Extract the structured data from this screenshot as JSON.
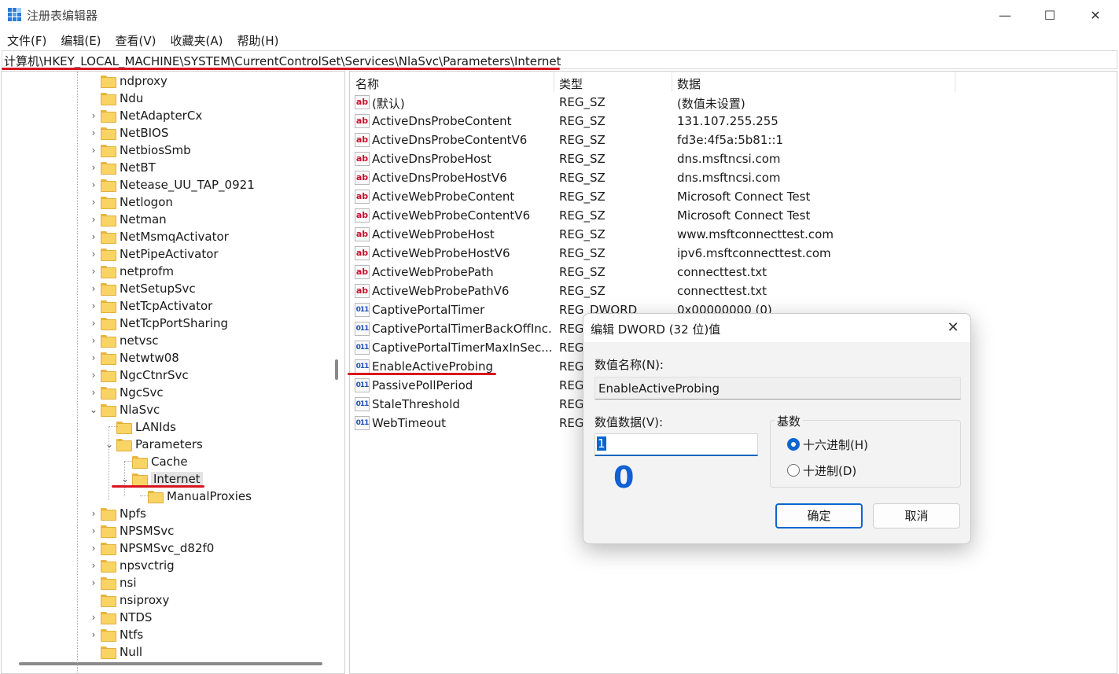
{
  "window": {
    "title": "注册表编辑器",
    "controls": {
      "minimize": "—",
      "maximize": "☐",
      "close": "✕"
    }
  },
  "menu": [
    "文件(F)",
    "编辑(E)",
    "查看(V)",
    "收藏夹(A)",
    "帮助(H)"
  ],
  "address": "计算机\\HKEY_LOCAL_MACHINE\\SYSTEM\\CurrentControlSet\\Services\\NlaSvc\\Parameters\\Internet",
  "tree": [
    {
      "label": "ndproxy",
      "expand": ""
    },
    {
      "label": "Ndu",
      "expand": ""
    },
    {
      "label": "NetAdapterCx",
      "expand": "›"
    },
    {
      "label": "NetBIOS",
      "expand": "›"
    },
    {
      "label": "NetbiosSmb",
      "expand": "›"
    },
    {
      "label": "NetBT",
      "expand": "›"
    },
    {
      "label": "Netease_UU_TAP_0921",
      "expand": "›"
    },
    {
      "label": "Netlogon",
      "expand": "›"
    },
    {
      "label": "Netman",
      "expand": "›"
    },
    {
      "label": "NetMsmqActivator",
      "expand": "›"
    },
    {
      "label": "NetPipeActivator",
      "expand": "›"
    },
    {
      "label": "netprofm",
      "expand": "›"
    },
    {
      "label": "NetSetupSvc",
      "expand": "›"
    },
    {
      "label": "NetTcpActivator",
      "expand": "›"
    },
    {
      "label": "NetTcpPortSharing",
      "expand": "›"
    },
    {
      "label": "netvsc",
      "expand": "›"
    },
    {
      "label": "Netwtw08",
      "expand": "›"
    },
    {
      "label": "NgcCtnrSvc",
      "expand": "›"
    },
    {
      "label": "NgcSvc",
      "expand": "›"
    },
    {
      "label": "NlaSvc",
      "expand": "⌄"
    },
    {
      "label": "LANIds",
      "expand": ""
    },
    {
      "label": "Parameters",
      "expand": "⌄"
    },
    {
      "label": "Cache",
      "expand": ""
    },
    {
      "label": "Internet",
      "expand": "⌄"
    },
    {
      "label": "ManualProxies",
      "expand": ""
    },
    {
      "label": "Npfs",
      "expand": "›"
    },
    {
      "label": "NPSMSvc",
      "expand": "›"
    },
    {
      "label": "NPSMSvc_d82f0",
      "expand": "›"
    },
    {
      "label": "npsvctrig",
      "expand": "›"
    },
    {
      "label": "nsi",
      "expand": "›"
    },
    {
      "label": "nsiproxy",
      "expand": ""
    },
    {
      "label": "NTDS",
      "expand": "›"
    },
    {
      "label": "Ntfs",
      "expand": "›"
    },
    {
      "label": "Null",
      "expand": ""
    }
  ],
  "columns": {
    "name": "名称",
    "type": "类型",
    "data": "数据"
  },
  "values": [
    {
      "icon": "ab",
      "name": "(默认)",
      "type": "REG_SZ",
      "data": "(数值未设置)"
    },
    {
      "icon": "ab",
      "name": "ActiveDnsProbeContent",
      "type": "REG_SZ",
      "data": "131.107.255.255"
    },
    {
      "icon": "ab",
      "name": "ActiveDnsProbeContentV6",
      "type": "REG_SZ",
      "data": "fd3e:4f5a:5b81::1"
    },
    {
      "icon": "ab",
      "name": "ActiveDnsProbeHost",
      "type": "REG_SZ",
      "data": "dns.msftncsi.com"
    },
    {
      "icon": "ab",
      "name": "ActiveDnsProbeHostV6",
      "type": "REG_SZ",
      "data": "dns.msftncsi.com"
    },
    {
      "icon": "ab",
      "name": "ActiveWebProbeContent",
      "type": "REG_SZ",
      "data": "Microsoft Connect Test"
    },
    {
      "icon": "ab",
      "name": "ActiveWebProbeContentV6",
      "type": "REG_SZ",
      "data": "Microsoft Connect Test"
    },
    {
      "icon": "ab",
      "name": "ActiveWebProbeHost",
      "type": "REG_SZ",
      "data": "www.msftconnecttest.com"
    },
    {
      "icon": "ab",
      "name": "ActiveWebProbeHostV6",
      "type": "REG_SZ",
      "data": "ipv6.msftconnecttest.com"
    },
    {
      "icon": "ab",
      "name": "ActiveWebProbePath",
      "type": "REG_SZ",
      "data": "connecttest.txt"
    },
    {
      "icon": "ab",
      "name": "ActiveWebProbePathV6",
      "type": "REG_SZ",
      "data": "connecttest.txt"
    },
    {
      "icon": "011",
      "name": "CaptivePortalTimer",
      "type": "REG_DWORD",
      "data": "0x00000000 (0)"
    },
    {
      "icon": "011",
      "name": "CaptivePortalTimerBackOffInc...",
      "type": "REG_",
      "data": ""
    },
    {
      "icon": "011",
      "name": "CaptivePortalTimerMaxInSec...",
      "type": "REG_",
      "data": ""
    },
    {
      "icon": "011",
      "name": "EnableActiveProbing",
      "type": "REG_",
      "data": ""
    },
    {
      "icon": "011",
      "name": "PassivePollPeriod",
      "type": "REG_",
      "data": ""
    },
    {
      "icon": "011",
      "name": "StaleThreshold",
      "type": "REG_",
      "data": ""
    },
    {
      "icon": "011",
      "name": "WebTimeout",
      "type": "REG_",
      "data": ""
    }
  ],
  "dialog": {
    "title": "编辑 DWORD (32 位)值",
    "close": "✕",
    "name_label": "数值名称(N):",
    "name_value": "EnableActiveProbing",
    "data_label": "数值数据(V):",
    "data_value": "1",
    "annotation": "0",
    "base_label": "基数",
    "hex_label": "十六进制(H)",
    "dec_label": "十进制(D)",
    "selected_base": "hex",
    "ok": "确定",
    "cancel": "取消"
  },
  "colors": {
    "annotation_red": "#d8151f",
    "accent_blue": "#0b66d0"
  }
}
